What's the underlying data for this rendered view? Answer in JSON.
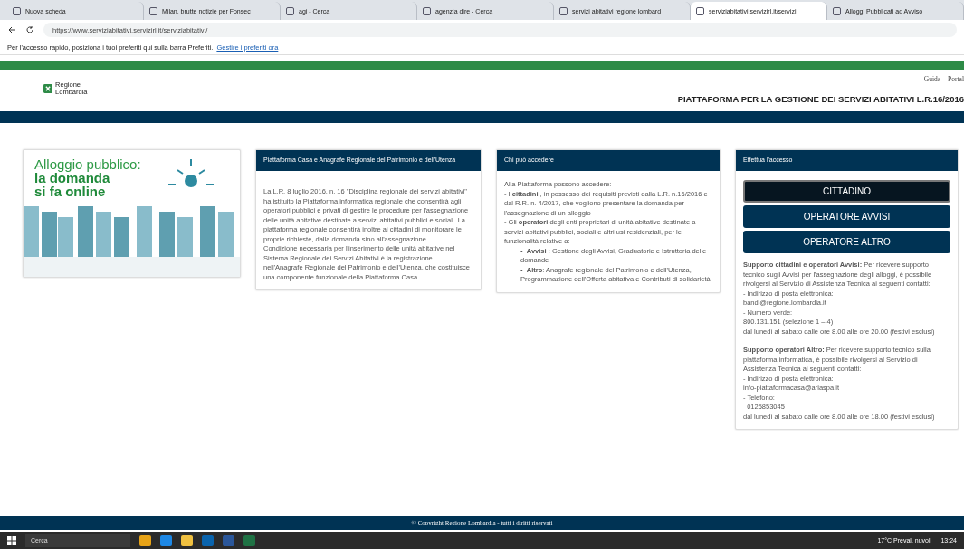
{
  "browser": {
    "tabs": [
      {
        "title": "Nuova scheda",
        "selected": false
      },
      {
        "title": "Milan, brutte notizie per Fonsec",
        "selected": false
      },
      {
        "title": "agi - Cerca",
        "selected": false
      },
      {
        "title": "agenzia dire - Cerca",
        "selected": false
      },
      {
        "title": "servizi abitativi regione lombard",
        "selected": false
      },
      {
        "title": "serviziabitativi.servizirl.it/servizi",
        "selected": true
      },
      {
        "title": "Alloggi Pubblicati ad Avviso",
        "selected": false
      }
    ],
    "url": "https://www.serviziabitativi.servizirl.it/serviziabitativi/",
    "favorites_hint": "Per l'accesso rapido, posiziona i tuoi preferiti qui sulla barra Preferiti.",
    "favorites_link": "Gestire i preferiti ora"
  },
  "header": {
    "logo": "Regione Lombardia",
    "links": [
      "Guida",
      "Portal"
    ],
    "title": "PIATTAFORMA PER LA GESTIONE DEI SERVIZI ABITATIVI L.R.16/2016"
  },
  "banner": {
    "line1": "Alloggio pubblico:",
    "line2": "la domanda",
    "line3": "si fa online"
  },
  "info_panel": {
    "title": "Piattaforma Casa e Anagrafe Regionale del Patrimonio e dell'Utenza",
    "paragraphs": [
      "La L.R. 8 luglio 2016, n. 16 \"Disciplina regionale dei servizi abitativi\" ha istituito la Piattaforma informatica regionale che consentirà agli operatori pubblici e privati di gestire le procedure per l'assegnazione delle unità abitative destinate a servizi abitativi pubblici e sociali. La piattaforma regionale consentirà inoltre ai cittadini di monitorare le proprie richieste, dalla domanda sino all'assegnazione.",
      "Condizione necessaria per l'inserimento delle unità abitative nel Sistema Regionale dei Servizi Abitativi è la registrazione nell'Anagrafe Regionale del Patrimonio e dell'Utenza, che costituisce una componente funzionale della Piattaforma Casa."
    ]
  },
  "access_panel": {
    "title": "Chi può accedere",
    "lines": [
      "Alla Piattaforma possono accedere:",
      "- I **cittadini** , in possesso dei requisiti previsti dalla L.R. n.16/2016 e dal R.R. n. 4/2017, che vogliono presentare la domanda per l'assegnazione di un alloggio",
      "- Gli **operatori** degli enti proprietari di unità abitative destinate a servizi abitativi pubblici, sociali e altri usi residenziali, per le funzionalità relative a:"
    ],
    "bullet_mark": "•",
    "bullets": [
      "**Avvisi** : Gestione degli Avvisi, Graduatorie e Istruttoria delle domande",
      "**Altro**: Anagrafe regionale del Patrimonio e dell'Utenza, Programmazione dell'Offerta abitativa e Contributi di solidarietà"
    ]
  },
  "login_panel": {
    "title": "Effettua l'accesso",
    "buttons": [
      {
        "label": "CITTADINO",
        "selected": true
      },
      {
        "label": "OPERATORE AVVISI",
        "selected": false
      },
      {
        "label": "OPERATORE ALTRO",
        "selected": false
      }
    ],
    "support": [
      {
        "intro": "**Supporto cittadini e operatori Avvisi:** Per ricevere supporto tecnico sugli Avvisi per l'assegnazione degli alloggi, è possibile rivolgersi al Servizio di Assistenza Tecnica ai seguenti contatti:",
        "lines": [
          "- Indirizzo di posta elettronica:",
          "bandi@regione.lombardia.it",
          "- Numero verde:",
          "800.131.151 (selezione 1 – 4)",
          "dal lunedì al sabato dalle ore 8.00 alle ore 20.00 (festivi esclusi)"
        ]
      },
      {
        "intro": "**Supporto operatori Altro:** Per ricevere supporto tecnico sulla piattaforma informatica, è possibile rivolgersi al Servizio di Assistenza Tecnica ai seguenti contatti:",
        "lines": [
          "- Indirizzo di posta elettronica:",
          "info-piattaformacasa@ariaspa.it",
          "- Telefono:",
          "  0125853045",
          "dal lunedì al sabato dalle ore 8.00 alle ore 18.00 (festivi esclusi)"
        ]
      }
    ]
  },
  "footer": "© Copyright Regione Lombardia - tutti i diritti riservati",
  "taskbar": {
    "search": "Cerca",
    "weather": "17°C  Preval. nuvol.",
    "time": "13:24"
  }
}
